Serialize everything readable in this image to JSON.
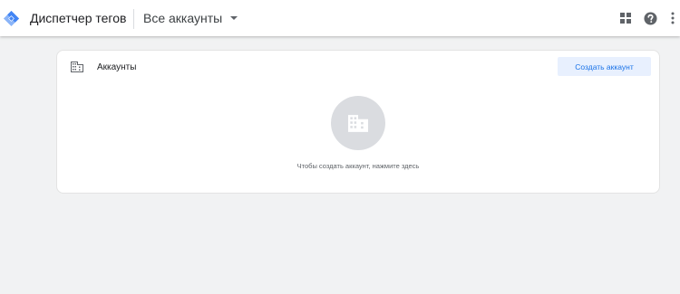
{
  "header": {
    "app_title": "Диспетчер тегов",
    "account_selector": "Все аккаунты",
    "icons": [
      "apps-grid-icon",
      "help-icon",
      "more-vert-icon"
    ]
  },
  "accounts_card": {
    "title": "Аккаунты",
    "create_button": "Создать аккаунт",
    "empty_message": "Чтобы создать аккаунт, нажмите здесь",
    "icons": [
      "building-icon"
    ]
  },
  "colors": {
    "brand_blue": "#4285f4",
    "brand_light_blue": "#8ab4f8",
    "button_bg": "#e8f0fe",
    "button_text": "#1a73e8",
    "page_bg": "#f1f2f3"
  }
}
